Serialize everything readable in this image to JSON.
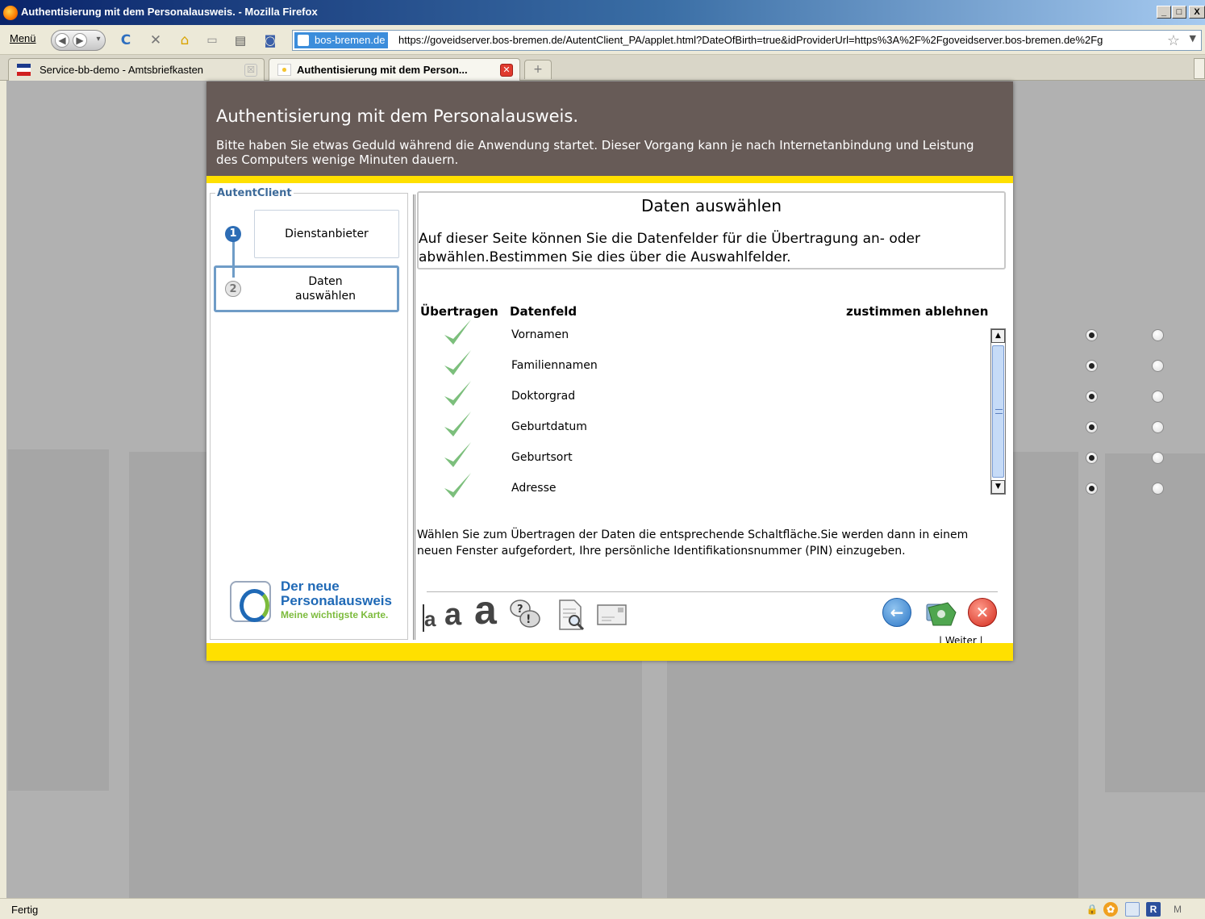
{
  "window": {
    "title": "Authentisierung mit dem Personalausweis. - Mozilla Firefox",
    "minimize": "_",
    "maximize": "□",
    "close": "X"
  },
  "toolbar": {
    "menu_label": "Menü",
    "site_identity": "bos-bremen.de",
    "url": "https://goveidserver.bos-bremen.de/AutentClient_PA/applet.html?DateOfBirth=true&idProviderUrl=https%3A%2F%2Fgoveidserver.bos-bremen.de%2Fg"
  },
  "tabs": [
    {
      "label": "Service-bb-demo - Amtsbriefkasten",
      "active": false
    },
    {
      "label": "Authentisierung mit dem Person...",
      "active": true
    }
  ],
  "applet": {
    "header_title": "Authentisierung mit dem Personalausweis.",
    "header_text": "Bitte haben Sie etwas Geduld während die Anwendung startet. Dieser Vorgang kann je nach Internetanbindung und Leistung des Computers wenige Minuten dauern.",
    "sidebar": {
      "legend": "AutentClient",
      "steps": [
        {
          "number": "1",
          "label": "Dienstanbieter"
        },
        {
          "number": "2",
          "label": "Daten auswählen"
        }
      ],
      "logo": {
        "line1": "Der neue",
        "line2": "Personalausweis",
        "line3": "Meine wichtigste Karte."
      }
    },
    "main": {
      "title": "Daten auswählen",
      "description": "Auf dieser Seite können Sie die Datenfelder für die Übertragung an- oder abwählen.Bestimmen Sie dies über die Auswahlfelder.",
      "columns": {
        "transfer": "Übertragen",
        "field": "Datenfeld",
        "accept": "zustimmen",
        "reject": "ablehnen"
      },
      "rows": [
        {
          "field": "Vornamen",
          "choice": "zustimmen"
        },
        {
          "field": "Familiennamen",
          "choice": "zustimmen"
        },
        {
          "field": "Doktorgrad",
          "choice": "zustimmen"
        },
        {
          "field": "Geburtdatum",
          "choice": "zustimmen"
        },
        {
          "field": "Geburtsort",
          "choice": "zustimmen"
        },
        {
          "field": "Adresse",
          "choice": "zustimmen"
        }
      ],
      "hint": "Wählen Sie zum Übertragen der Daten die entsprechende Schaltfläche.Sie werden dann in einem neuen Fenster aufgefordert, Ihre persönliche Identifikationsnummer (PIN) einzugeben.",
      "font_sizes": [
        "a",
        "a",
        "a"
      ],
      "weiter_label": "| Weiter |"
    }
  },
  "statusbar": {
    "text": "Fertig",
    "icons": [
      "lock-icon",
      "addon-icon",
      "page-icon",
      "R",
      "M"
    ]
  },
  "colors": {
    "header_bg": "#675b57",
    "accent_yellow": "#ffe000",
    "step_blue": "#6f9cc7",
    "check_green": "#7cbf7c"
  }
}
